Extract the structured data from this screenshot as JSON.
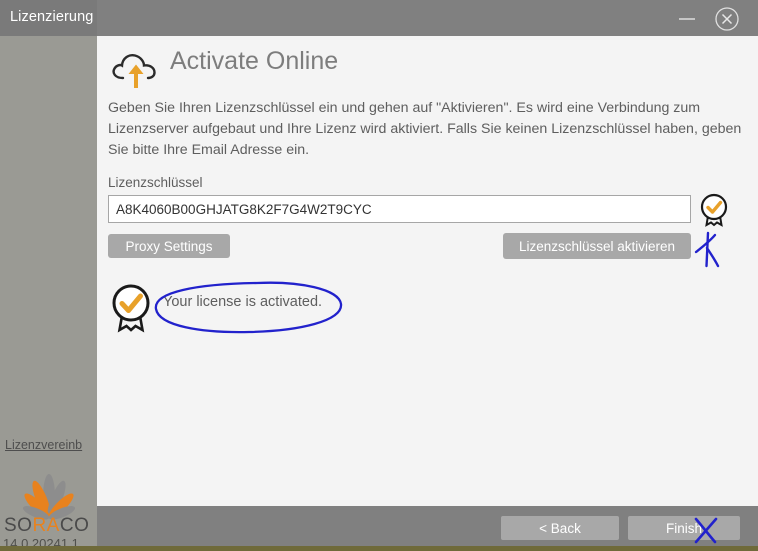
{
  "window": {
    "title": "Lizenzierung",
    "minimize_icon": "minimize-icon",
    "close_icon": "close-circle-icon"
  },
  "sidebar": {
    "eula_link": "Lizenzvereinb",
    "brand_first": "SO",
    "brand_mid": "RA",
    "brand_last": "CO",
    "logo_icon": "soraco-flower-logo",
    "version": "14.0.20241.1"
  },
  "main": {
    "header_icon": "cloud-upload-icon",
    "title": "Activate Online",
    "description": "Geben Sie Ihren Lizenzschlüssel ein und gehen auf \"Aktivieren\". Es wird eine Verbindung zum Lizenzserver aufgebaut und Ihre Lizenz wird aktiviert. Falls Sie keinen Lizenzschlüssel haben, geben Sie bitte Ihre Email Adresse ein.",
    "key_label": "Lizenzschlüssel",
    "key_value": "A8K4060B00GHJATG8K2F7G4W2T9CYC",
    "key_placeholder": "",
    "key_badge_icon": "award-badge-check-icon",
    "proxy_button": "Proxy Settings",
    "activate_button": "Lizenzschlüssel aktivieren",
    "status_icon": "award-badge-check-icon-large",
    "status_text": "Your license is activated.",
    "annotation_circle": "hand-drawn-blue-ellipse",
    "annotation_arrow": "hand-drawn-blue-arrow",
    "annotation_cross": "hand-drawn-blue-cross"
  },
  "footer": {
    "back_button": "< Back",
    "finish_button": "Finish"
  },
  "colors": {
    "titlebar": "#808080",
    "sidebar": "#9a9a94",
    "content": "#f4f4f4",
    "accent_orange": "#e8821e",
    "button": "#a8a8a8",
    "ink_blue": "#2222cc",
    "desktop": "#6f6a3a"
  }
}
